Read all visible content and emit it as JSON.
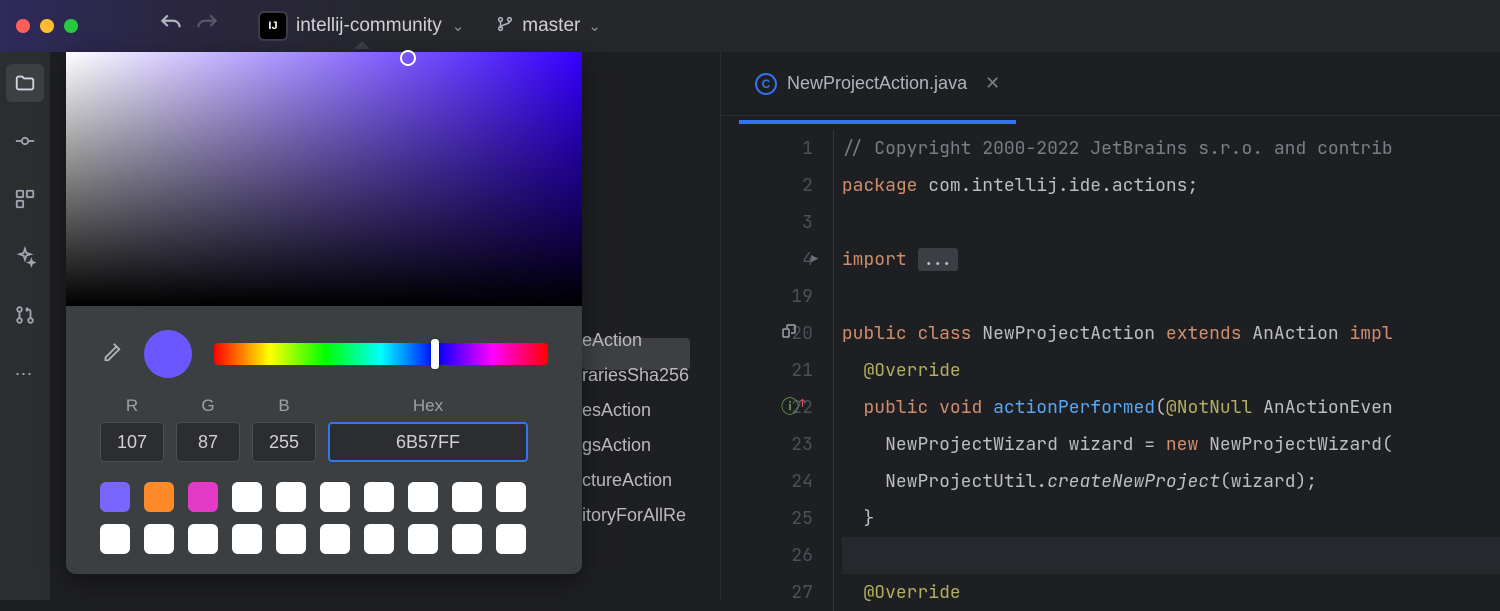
{
  "titlebar": {
    "project": "intellij-community",
    "branch": "master"
  },
  "colorPicker": {
    "r_label": "R",
    "g_label": "G",
    "b_label": "B",
    "hex_label": "Hex",
    "r": "107",
    "g": "87",
    "b": "255",
    "hex": "6B57FF",
    "currentColor": "#6b57ff",
    "hue": "#3500ff",
    "swatchRow1": [
      "#7866ff",
      "#ff8a2a",
      "#e33ac8",
      "#ffffff",
      "#ffffff",
      "#ffffff",
      "#ffffff",
      "#ffffff",
      "#ffffff",
      "#ffffff"
    ],
    "swatchRow2": [
      "#ffffff",
      "#ffffff",
      "#ffffff",
      "#ffffff",
      "#ffffff",
      "#ffffff",
      "#ffffff",
      "#ffffff",
      "#ffffff",
      "#ffffff"
    ]
  },
  "bgList": [
    "eAction",
    "rariesSha256",
    "esAction",
    "gsAction",
    "ctureAction",
    "itoryForAllRe"
  ],
  "editor": {
    "tabName": "NewProjectAction.java",
    "lines": [
      {
        "n": "1",
        "html": "<span class='cmt'>// Copyright 2000-2022 JetBrains s.r.o. and contrib</span>"
      },
      {
        "n": "2",
        "html": "<span class='kw'>package</span> com.intellij.ide.actions;"
      },
      {
        "n": "3",
        "html": ""
      },
      {
        "n": "4",
        "html": "<span class='kw'>import</span> <span class='fold-box'>...</span>",
        "foldArrow": true
      },
      {
        "n": "19",
        "html": ""
      },
      {
        "n": "20",
        "html": "<span class='kw'>public class</span> NewProjectAction <span class='kw'>extends</span> AnAction <span class='kw'>impl</span>",
        "icon": "el"
      },
      {
        "n": "21",
        "html": "  <span class='ann'>@Override</span>"
      },
      {
        "n": "22",
        "html": "  <span class='kw'>public void</span> <span class='mth'>actionPerformed</span>(<span class='ann'>@NotNull</span> AnActionEven",
        "icon": "usage"
      },
      {
        "n": "23",
        "html": "    NewProjectWizard wizard = <span class='kw'>new</span> NewProjectWizard("
      },
      {
        "n": "24",
        "html": "    NewProjectUtil.<span class='it'>createNewProject</span>(wizard);"
      },
      {
        "n": "25",
        "html": "  }"
      },
      {
        "n": "26",
        "html": "",
        "current": true
      },
      {
        "n": "27",
        "html": "  <span class='ann'>@Override</span>"
      }
    ]
  }
}
